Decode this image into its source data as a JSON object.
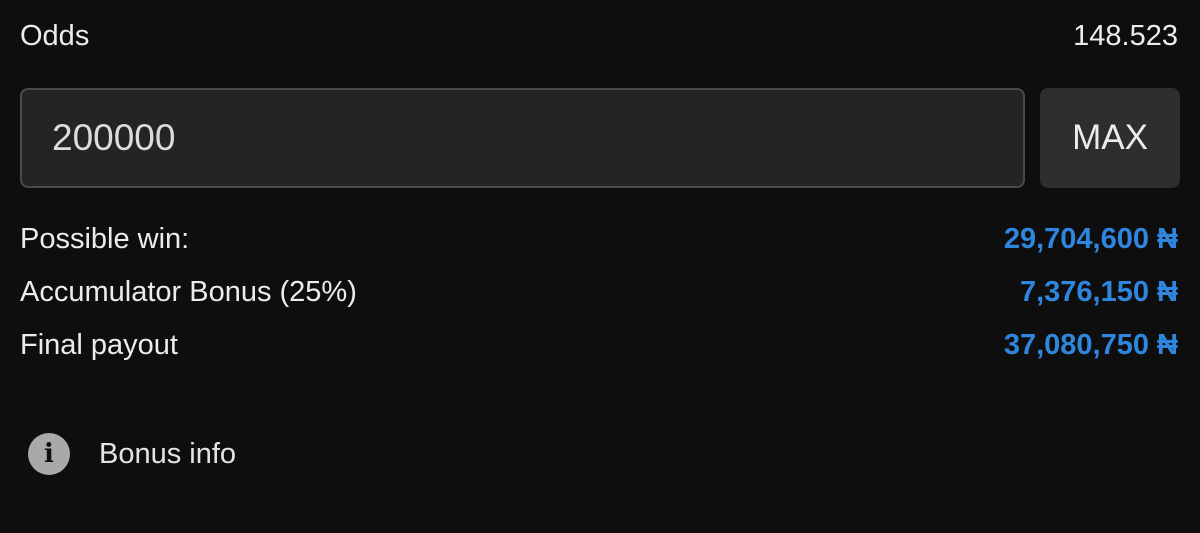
{
  "odds": {
    "label": "Odds",
    "value": "148.523"
  },
  "stake": {
    "value": "200000",
    "max_label": "MAX"
  },
  "summary": {
    "rows": [
      {
        "label": "Possible win:",
        "value": "29,704,600 ₦"
      },
      {
        "label": "Accumulator Bonus (25%)",
        "value": "7,376,150 ₦"
      },
      {
        "label": "Final payout",
        "value": "37,080,750 ₦"
      }
    ]
  },
  "bonus_info": {
    "icon": "info-icon",
    "icon_glyph": "i",
    "label": "Bonus info"
  },
  "colors": {
    "background": "#0e0e0f",
    "accent": "#2e86de",
    "input_background": "#242425",
    "button_background": "#2e2e30"
  }
}
